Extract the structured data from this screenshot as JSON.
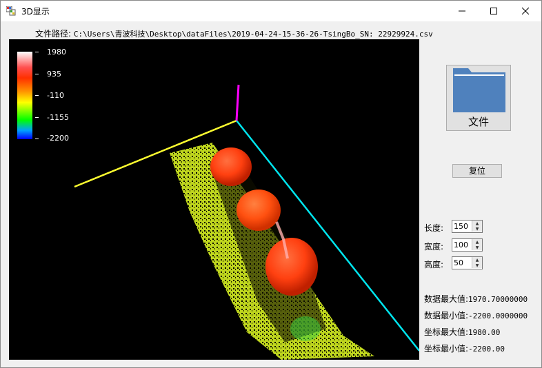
{
  "window": {
    "title": "3D显示",
    "minimize_glyph": "—",
    "maximize_glyph": "☐",
    "close_glyph": "✕"
  },
  "file_path": {
    "label": "文件路径:",
    "value": "C:\\Users\\青波科技\\Desktop\\dataFiles\\2019-04-24-15-36-26-TsingBo_SN: 22929924.csv"
  },
  "colorbar": {
    "labels": [
      "1980",
      "935",
      "-110",
      "-1155",
      "-2200"
    ]
  },
  "file_button": {
    "label": "文件",
    "icon": "folder-icon"
  },
  "reset_button": {
    "label": "复位"
  },
  "params": {
    "length": {
      "label": "长度:",
      "value": "150"
    },
    "width": {
      "label": "宽度:",
      "value": "100"
    },
    "height": {
      "label": "高度:",
      "value": "50"
    }
  },
  "stats": {
    "data_max": {
      "label": "数据最大值:",
      "value": "1970.70000000"
    },
    "data_min": {
      "label": "数据最小值:",
      "value": "-2200.0000000"
    },
    "coord_max": {
      "label": "坐标最大值:",
      "value": "1980.00"
    },
    "coord_min": {
      "label": "坐标最小值:",
      "value": "-2200.00"
    }
  },
  "colors": {
    "axis_x": "#ffff30",
    "axis_y": "#00e5ee",
    "axis_z": "#ff00ff",
    "viewport_bg": "#000000",
    "folder": "#4f81bd"
  }
}
